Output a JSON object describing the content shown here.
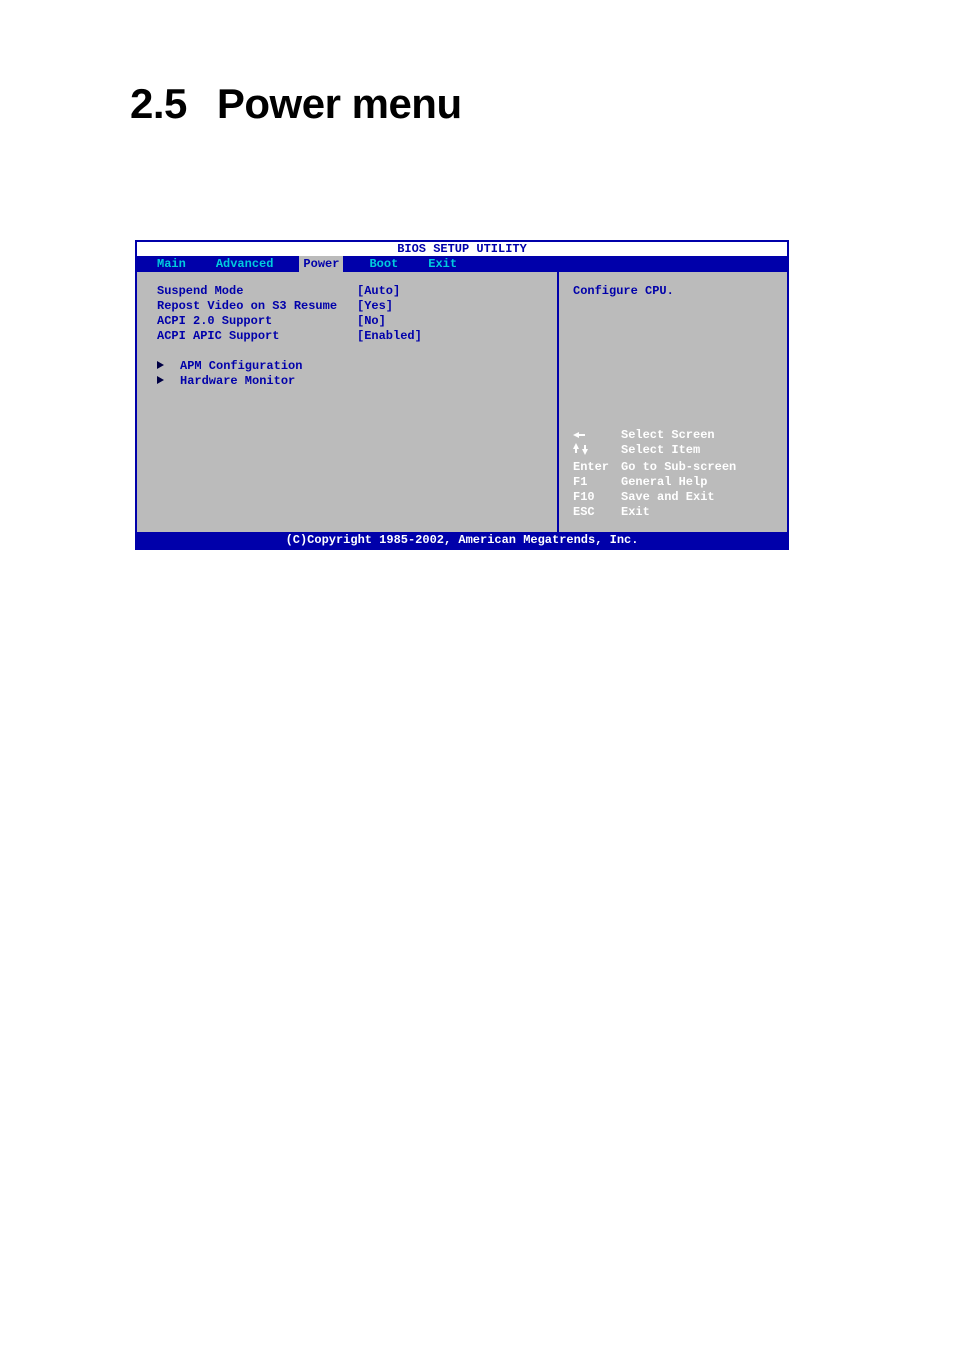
{
  "page": {
    "section_number": "2.5",
    "section_title": "Power menu"
  },
  "bios": {
    "title": "BIOS SETUP UTILITY",
    "tabs": {
      "main": "Main",
      "advanced": "Advanced",
      "power": "Power",
      "boot": "Boot",
      "exit": "Exit"
    },
    "settings": [
      {
        "label": "Suspend Mode",
        "value": "[Auto]"
      },
      {
        "label": "Repost Video on S3 Resume",
        "value": "[Yes]"
      },
      {
        "label": "ACPI 2.0 Support",
        "value": "[No]"
      },
      {
        "label": "ACPI APIC Support",
        "value": "[Enabled]"
      }
    ],
    "submenus": [
      {
        "label": "APM Configuration"
      },
      {
        "label": "Hardware Monitor"
      }
    ],
    "help_text": "Configure CPU.",
    "nav": [
      {
        "key_icon": "arrow-left",
        "desc": "Select Screen"
      },
      {
        "key_icon": "arrow-updown",
        "desc": "Select Item"
      },
      {
        "key": "Enter",
        "desc": "Go to Sub-screen"
      },
      {
        "key": "F1",
        "desc": "General Help"
      },
      {
        "key": "F10",
        "desc": "Save and Exit"
      },
      {
        "key": "ESC",
        "desc": "Exit"
      }
    ],
    "footer": "(C)Copyright 1985-2002, American Megatrends, Inc."
  }
}
